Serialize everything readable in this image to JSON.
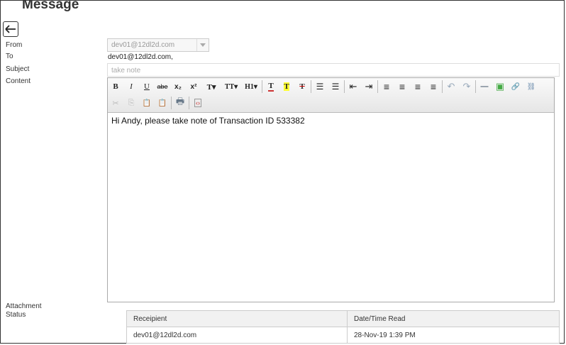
{
  "page": {
    "title": "Message"
  },
  "form": {
    "from_label": "From",
    "from_value": "dev01@12dl2d.com",
    "to_label": "To",
    "to_value": "dev01@12dl2d.com,",
    "subject_label": "Subject",
    "subject_placeholder": "take note",
    "content_label": "Content",
    "attachment_label": "Attachment",
    "status_label": "Status"
  },
  "editor": {
    "content": "Hi Andy, please take note of Transaction ID 533382",
    "toolbar_row1": [
      {
        "icon": "bold-icon",
        "text": "B"
      },
      {
        "icon": "italic-icon",
        "text": "I"
      },
      {
        "icon": "underline-icon",
        "text": "U"
      },
      {
        "icon": "strikethrough-icon",
        "text": "abe"
      },
      {
        "icon": "subscript-icon",
        "text": "x₂"
      },
      {
        "icon": "superscript-icon",
        "text": "x²"
      },
      {
        "icon": "font-size-icon",
        "text": "T▾"
      },
      {
        "icon": "font-family-icon",
        "text": "ТТ▾"
      },
      {
        "icon": "heading-icon",
        "text": "H1▾"
      },
      {
        "icon": "text-color-icon",
        "text": "T"
      },
      {
        "icon": "highlight-icon",
        "text": "T"
      },
      {
        "icon": "clear-format-icon",
        "text": "T"
      },
      {
        "icon": "bullet-list-icon",
        "text": "☰"
      },
      {
        "icon": "numbered-list-icon",
        "text": "☰"
      },
      {
        "icon": "outdent-icon",
        "text": "⇤"
      },
      {
        "icon": "indent-icon",
        "text": "⇥"
      },
      {
        "icon": "align-left-icon",
        "text": "≡"
      },
      {
        "icon": "align-center-icon",
        "text": "≡"
      },
      {
        "icon": "align-right-icon",
        "text": "≡"
      },
      {
        "icon": "align-justify-icon",
        "text": "≡"
      },
      {
        "icon": "undo-icon",
        "text": "↶"
      },
      {
        "icon": "redo-icon",
        "text": "↷"
      },
      {
        "icon": "horizontal-rule-icon",
        "text": "—"
      },
      {
        "icon": "image-icon",
        "text": "▣"
      },
      {
        "icon": "link-icon",
        "text": "🔗"
      },
      {
        "icon": "unlink-icon",
        "text": "⛓"
      }
    ],
    "toolbar_row2": [
      {
        "icon": "cut-icon",
        "text": "✂"
      },
      {
        "icon": "copy-icon",
        "text": "⎘"
      },
      {
        "icon": "paste-icon",
        "text": "📋"
      },
      {
        "icon": "paste-text-icon",
        "text": "📋"
      },
      {
        "icon": "print-icon",
        "text": "🖶"
      },
      {
        "icon": "source-code-icon",
        "text": "‹›"
      }
    ]
  },
  "attachment_table": {
    "headers": [
      "Receipient",
      "Date/Time Read"
    ],
    "rows": [
      [
        "dev01@12dl2d.com",
        "28-Nov-19 1:39 PM"
      ]
    ]
  }
}
